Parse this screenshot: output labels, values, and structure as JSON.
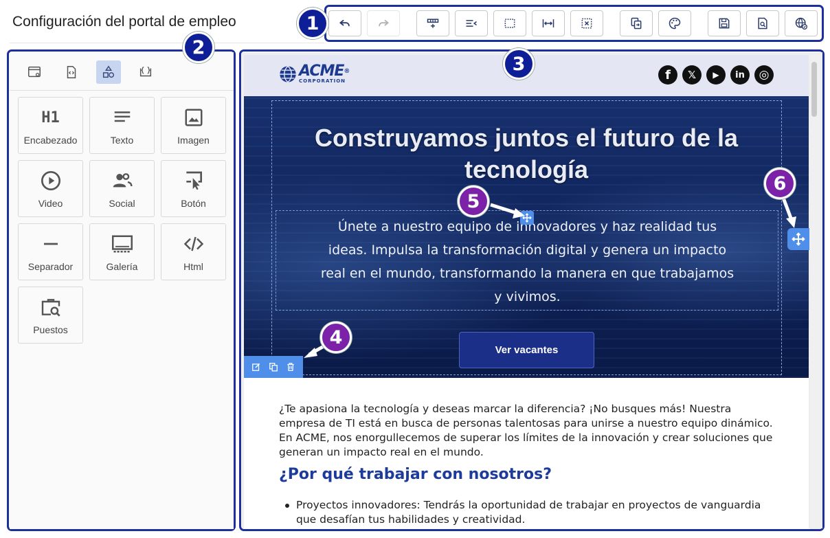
{
  "page": {
    "title": "Configuración del portal de empleo"
  },
  "badges": {
    "one": "1",
    "two": "2",
    "three": "3",
    "four": "4",
    "five": "5",
    "six": "6"
  },
  "toolbar": {
    "buttons": [
      {
        "icon": "undo-icon",
        "enabled": true
      },
      {
        "icon": "redo-icon",
        "enabled": false
      },
      {
        "icon": "insert-row-icon",
        "enabled": true
      },
      {
        "icon": "align-left-icon",
        "enabled": true
      },
      {
        "icon": "select-box-icon",
        "enabled": true
      },
      {
        "icon": "fit-width-icon",
        "enabled": true
      },
      {
        "icon": "remove-selection-icon",
        "enabled": true
      },
      {
        "icon": "copy-icon",
        "enabled": true
      },
      {
        "icon": "palette-icon",
        "enabled": true
      },
      {
        "icon": "save-icon",
        "enabled": true
      },
      {
        "icon": "preview-icon",
        "enabled": true
      },
      {
        "icon": "publish-globe-icon",
        "enabled": true
      }
    ]
  },
  "sidebar": {
    "tabs": [
      {
        "icon": "page-settings-icon",
        "active": false
      },
      {
        "icon": "code-file-icon",
        "active": false
      },
      {
        "icon": "blocks-icon",
        "active": true
      },
      {
        "icon": "code-braces-icon",
        "active": false
      }
    ],
    "blocks": [
      {
        "label": "Encabezado",
        "icon": "heading-icon",
        "glyph": "H1"
      },
      {
        "label": "Texto",
        "icon": "text-icon"
      },
      {
        "label": "Imagen",
        "icon": "image-icon"
      },
      {
        "label": "Video",
        "icon": "play-icon"
      },
      {
        "label": "Social",
        "icon": "people-icon"
      },
      {
        "label": "Botón",
        "icon": "button-click-icon"
      },
      {
        "label": "Separador",
        "icon": "separator-icon"
      },
      {
        "label": "Galería",
        "icon": "gallery-icon"
      },
      {
        "label": "Html",
        "icon": "html-code-icon"
      },
      {
        "label": "Puestos",
        "icon": "job-search-icon"
      }
    ]
  },
  "site": {
    "logo": {
      "name": "ACME",
      "sub": "CORPORATION",
      "mark": "®"
    },
    "social": [
      {
        "icon": "facebook-icon",
        "glyph": "f"
      },
      {
        "icon": "x-icon",
        "glyph": "𝕏"
      },
      {
        "icon": "youtube-icon",
        "glyph": "▶"
      },
      {
        "icon": "linkedin-icon",
        "glyph": "in"
      },
      {
        "icon": "instagram-icon",
        "glyph": "◎"
      }
    ],
    "hero": {
      "title": "Construyamos juntos el futuro de la tecnología",
      "text": "Únete a nuestro equipo de innovadores y haz realidad tus ideas. Impulsa la transformación digital y genera un impacto real en el mundo, transformando la manera en que trabajamos y vivimos.",
      "button": "Ver vacantes"
    },
    "intro": "¿Te apasiona la tecnología y deseas marcar la diferencia? ¡No busques más! Nuestra empresa de TI está en busca de personas talentosas para unirse a nuestro equipo dinámico. En ACME, nos enorgullecemos de superar los límites de la innovación y crear soluciones que generan un impacto real en el mundo.",
    "why_title": "¿Por qué trabajar con nosotros?",
    "bullets": [
      "Proyectos innovadores: Tendrás la oportunidad de trabajar en proyectos de vanguardia que desafían tus habilidades y creatividad."
    ]
  },
  "colors": {
    "frame": "#1d2f9c",
    "badge_blue": "#0d1e96",
    "badge_purple": "#7b22a8",
    "accent": "#4f8fe9",
    "heading_blue": "#1d3b9b"
  }
}
